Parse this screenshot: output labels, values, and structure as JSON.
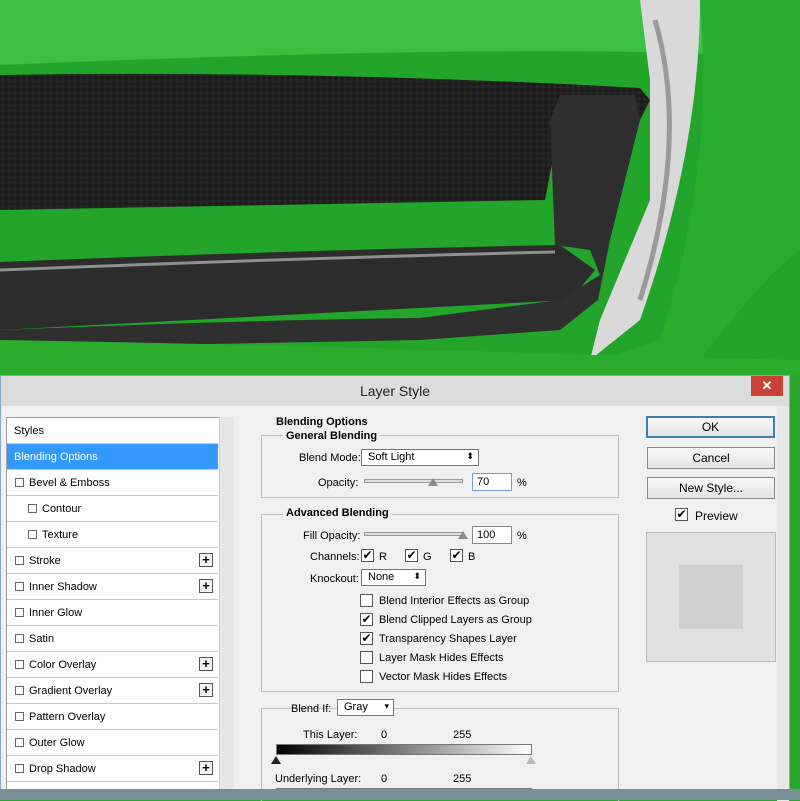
{
  "dialog": {
    "title": "Layer Style",
    "close_glyph": "✕"
  },
  "styles_list": {
    "items": [
      {
        "label": "Styles",
        "checkbox": false,
        "plus": false,
        "indent": 0,
        "selected": false
      },
      {
        "label": "Blending Options",
        "checkbox": false,
        "plus": false,
        "indent": 0,
        "selected": true
      },
      {
        "label": "Bevel & Emboss",
        "checkbox": true,
        "plus": false,
        "indent": 0,
        "selected": false
      },
      {
        "label": "Contour",
        "checkbox": true,
        "plus": false,
        "indent": 1,
        "selected": false
      },
      {
        "label": "Texture",
        "checkbox": true,
        "plus": false,
        "indent": 1,
        "selected": false
      },
      {
        "label": "Stroke",
        "checkbox": true,
        "plus": true,
        "indent": 0,
        "selected": false
      },
      {
        "label": "Inner Shadow",
        "checkbox": true,
        "plus": true,
        "indent": 0,
        "selected": false
      },
      {
        "label": "Inner Glow",
        "checkbox": true,
        "plus": false,
        "indent": 0,
        "selected": false
      },
      {
        "label": "Satin",
        "checkbox": true,
        "plus": false,
        "indent": 0,
        "selected": false
      },
      {
        "label": "Color Overlay",
        "checkbox": true,
        "plus": true,
        "indent": 0,
        "selected": false
      },
      {
        "label": "Gradient Overlay",
        "checkbox": true,
        "plus": true,
        "indent": 0,
        "selected": false
      },
      {
        "label": "Pattern Overlay",
        "checkbox": true,
        "plus": false,
        "indent": 0,
        "selected": false
      },
      {
        "label": "Outer Glow",
        "checkbox": true,
        "plus": false,
        "indent": 0,
        "selected": false
      },
      {
        "label": "Drop Shadow",
        "checkbox": true,
        "plus": true,
        "indent": 0,
        "selected": false
      }
    ],
    "plus_glyph": "+"
  },
  "blending": {
    "section_title": "Blending Options",
    "general": {
      "title": "General Blending",
      "blend_mode_label": "Blend Mode:",
      "blend_mode_value": "Soft Light",
      "opacity_label": "Opacity:",
      "opacity_value": "70",
      "opacity_percent": 70,
      "percent": "%"
    },
    "advanced": {
      "title": "Advanced Blending",
      "fill_opacity_label": "Fill Opacity:",
      "fill_opacity_value": "100",
      "fill_opacity_percent": 100,
      "percent": "%",
      "channels_label": "Channels:",
      "channels": [
        {
          "label": "R",
          "checked": true
        },
        {
          "label": "G",
          "checked": true
        },
        {
          "label": "B",
          "checked": true
        }
      ],
      "knockout_label": "Knockout:",
      "knockout_value": "None",
      "options": [
        {
          "label": "Blend Interior Effects as Group",
          "checked": false
        },
        {
          "label": "Blend Clipped Layers as Group",
          "checked": true
        },
        {
          "label": "Transparency Shapes Layer",
          "checked": true
        },
        {
          "label": "Layer Mask Hides Effects",
          "checked": false
        },
        {
          "label": "Vector Mask Hides Effects",
          "checked": false
        }
      ]
    },
    "blend_if": {
      "label": "Blend If:",
      "value": "Gray",
      "this_layer_label": "This Layer:",
      "this_layer_min": "0",
      "this_layer_max": "255",
      "underlying_label": "Underlying Layer:",
      "underlying_min": "0",
      "underlying_max": "255"
    }
  },
  "buttons": {
    "ok": "OK",
    "cancel": "Cancel",
    "new_style": "New Style...",
    "preview_label": "Preview",
    "preview_checked": true
  },
  "glyphs": {
    "check": "✔",
    "updown": "⬍",
    "down": "▾"
  },
  "colors": {
    "selection": "#3399ff",
    "close_button": "#c9423a",
    "car_green": "#2aa52e"
  }
}
